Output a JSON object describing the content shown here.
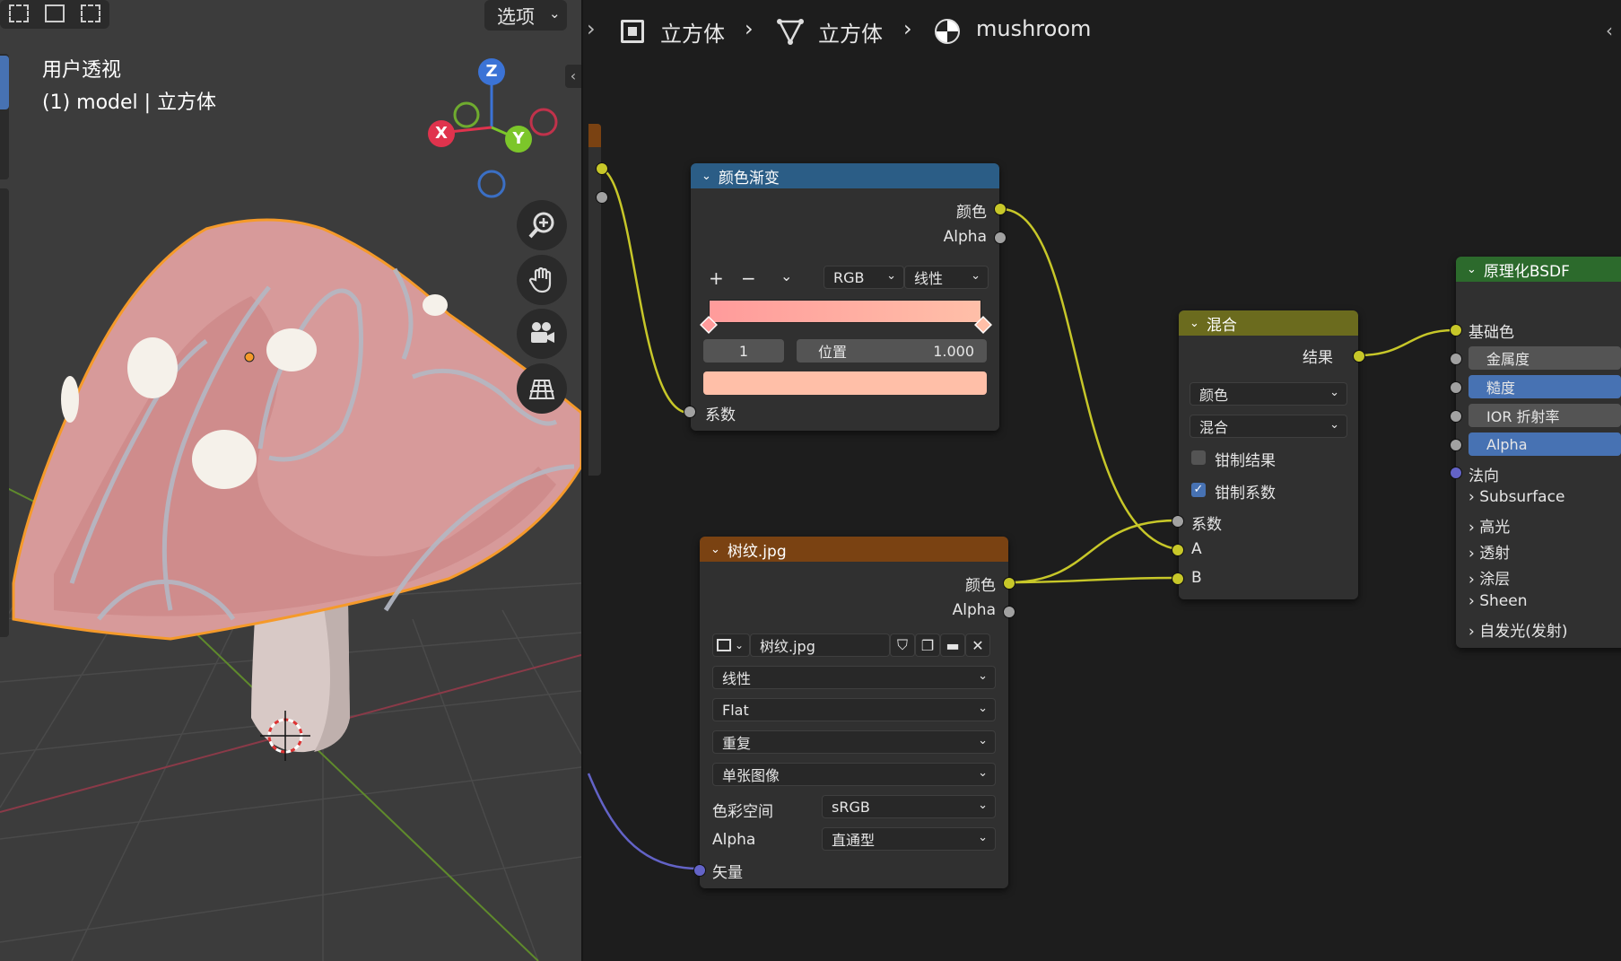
{
  "viewport": {
    "mode_label": "选项",
    "view_name": "用户透视",
    "object_info": "(1) model | 立方体",
    "gizmo": {
      "z": "Z",
      "x": "X",
      "y": "Y"
    },
    "tools": [
      "zoom-icon",
      "hand-icon",
      "camera-icon",
      "grid-view-icon"
    ]
  },
  "breadcrumb": {
    "items": [
      "立方体",
      "立方体",
      "mushroom"
    ]
  },
  "nodes": {
    "color_ramp": {
      "title": "颜色渐变",
      "out_color": "颜色",
      "out_alpha": "Alpha",
      "color_mode": "RGB",
      "interpolation": "线性",
      "stop_index": "1",
      "position_label": "位置",
      "position_value": "1.000",
      "in_factor": "系数",
      "ramp_start_color": "#ff9b9b",
      "ramp_end_color": "#ffbfa8"
    },
    "image_texture": {
      "title": "树纹.jpg",
      "out_color": "颜色",
      "out_alpha": "Alpha",
      "image_name": "树纹.jpg",
      "interpolation": "线性",
      "projection": "Flat",
      "extension": "重复",
      "source": "单张图像",
      "colorspace_label": "色彩空间",
      "colorspace_value": "sRGB",
      "alpha_label": "Alpha",
      "alpha_value": "直通型",
      "in_vector": "矢量"
    },
    "mix": {
      "title": "混合",
      "out_result": "结果",
      "data_type": "颜色",
      "blend_mode": "混合",
      "clamp_result": "钳制结果",
      "clamp_result_checked": false,
      "clamp_factor": "钳制系数",
      "clamp_factor_checked": true,
      "in_factor": "系数",
      "in_a": "A",
      "in_b": "B"
    },
    "bsdf": {
      "title": "原理化BSDF",
      "base_color": "基础色",
      "metallic": "金属度",
      "roughness": "糙度",
      "ior": "IOR 折射率",
      "alpha": "Alpha",
      "normal": "法向",
      "panels": [
        "Subsurface",
        "高光",
        "透射",
        "涂层",
        "Sheen",
        "自发光(发射)"
      ]
    }
  },
  "colors": {
    "ramp_header": "#2b5d86",
    "image_header": "#7a4212",
    "mix_header": "#6b6b1e",
    "bsdf_header": "#2c6a2c",
    "selection": "#f59a2a",
    "accent": "#4772b3"
  }
}
